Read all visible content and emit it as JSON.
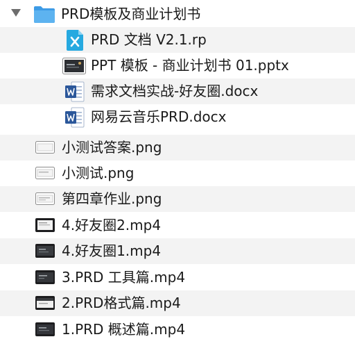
{
  "folder": {
    "name": "PRD模板及商业计划书",
    "expanded": true,
    "icon": "folder-icon",
    "children": [
      {
        "name": "PRD 文档 V2.1.rp",
        "icon": "axure-rp-icon"
      },
      {
        "name": "PPT 模板 - 商业计划书 01.pptx",
        "icon": "pptx-preview-icon"
      },
      {
        "name": "需求文档实战-好友圈.docx",
        "icon": "word-docx-icon"
      },
      {
        "name": "网易云音乐PRD.docx",
        "icon": "word-docx-icon"
      }
    ]
  },
  "files": [
    {
      "name": "小测试答案.png",
      "icon": "png-thumbnail-icon"
    },
    {
      "name": "小测试.png",
      "icon": "png-thumbnail-icon"
    },
    {
      "name": "第四章作业.png",
      "icon": "png-thumbnail-icon"
    },
    {
      "name": "4.好友圈2.mp4",
      "icon": "video-thumbnail-icon"
    },
    {
      "name": "4.好友圈1.mp4",
      "icon": "video-thumbnail-icon"
    },
    {
      "name": "3.PRD 工具篇.mp4",
      "icon": "video-thumbnail-icon"
    },
    {
      "name": "2.PRD格式篇.mp4",
      "icon": "video-thumbnail-icon"
    },
    {
      "name": "1.PRD 概述篇.mp4",
      "icon": "video-thumbnail-icon"
    }
  ],
  "colors": {
    "folder": "#4aa8ec",
    "axure": "#26a9e0",
    "word": "#2b579a",
    "row_alt": "#f3f3f3"
  }
}
